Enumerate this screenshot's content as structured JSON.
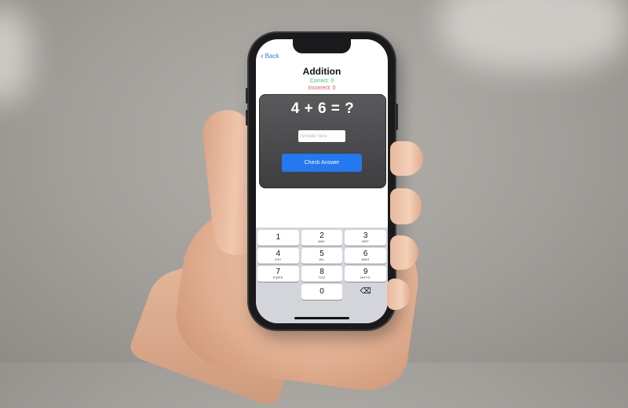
{
  "nav": {
    "back_label": "Back"
  },
  "quiz": {
    "title": "Addition",
    "correct_text": "Correct: 0",
    "incorrect_text": "Incorrect: 0",
    "question": "4 + 6 = ?",
    "answer_placeholder": "Answer here",
    "answer_value": "",
    "check_label": "Check Answer"
  },
  "keypad": {
    "rows": [
      [
        {
          "num": "1",
          "letters": ""
        },
        {
          "num": "2",
          "letters": "ABC"
        },
        {
          "num": "3",
          "letters": "DEF"
        }
      ],
      [
        {
          "num": "4",
          "letters": "GHI"
        },
        {
          "num": "5",
          "letters": "JKL"
        },
        {
          "num": "6",
          "letters": "MNO"
        }
      ],
      [
        {
          "num": "7",
          "letters": "PQRS"
        },
        {
          "num": "8",
          "letters": "TUV"
        },
        {
          "num": "9",
          "letters": "WXYZ"
        }
      ],
      [
        {
          "num": "",
          "letters": ""
        },
        {
          "num": "0",
          "letters": ""
        },
        {
          "num": "⌫",
          "letters": ""
        }
      ]
    ],
    "delete_icon": "backspace-icon"
  },
  "colors": {
    "accent": "#2478f0",
    "correct": "#3ac267",
    "incorrect": "#ee4f4f",
    "card": "#4a4a4c"
  }
}
